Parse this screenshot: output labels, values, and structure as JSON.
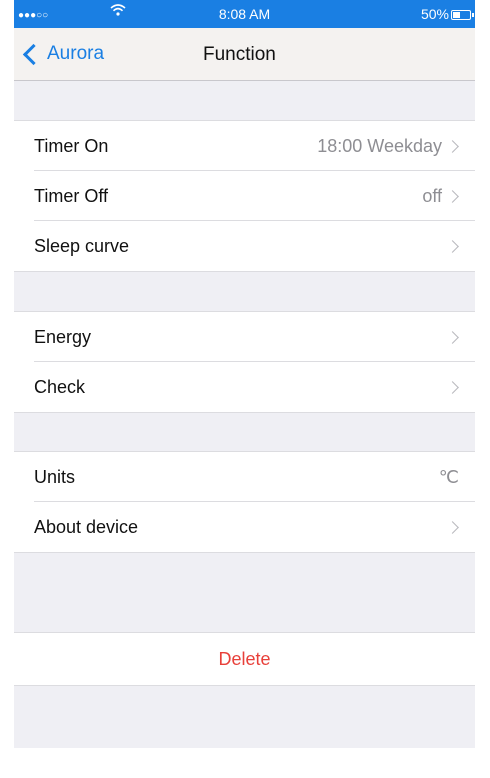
{
  "status": {
    "signal": "●●●○○",
    "time": "8:08 AM",
    "battery": "50%",
    "battery_level": 0.5
  },
  "nav": {
    "back_label": "Aurora",
    "title": "Function"
  },
  "group1": [
    {
      "label": "Timer On",
      "value": "18:00 Weekday"
    },
    {
      "label": "Timer Off",
      "value": "off"
    },
    {
      "label": "Sleep curve",
      "value": ""
    }
  ],
  "group2": [
    {
      "label": "Energy",
      "value": ""
    },
    {
      "label": "Check",
      "value": ""
    }
  ],
  "group3": [
    {
      "label": "Units",
      "value": "℃"
    },
    {
      "label": "About device",
      "value": ""
    }
  ],
  "delete_label": "Delete",
  "colors": {
    "accent": "#1a7fe3",
    "destructive": "#e8403a",
    "background": "#efeff4"
  },
  "icons": {
    "wifi": "wifi-icon",
    "battery": "battery-icon",
    "back": "chevron-left-icon",
    "disclosure": "chevron-right-icon"
  }
}
